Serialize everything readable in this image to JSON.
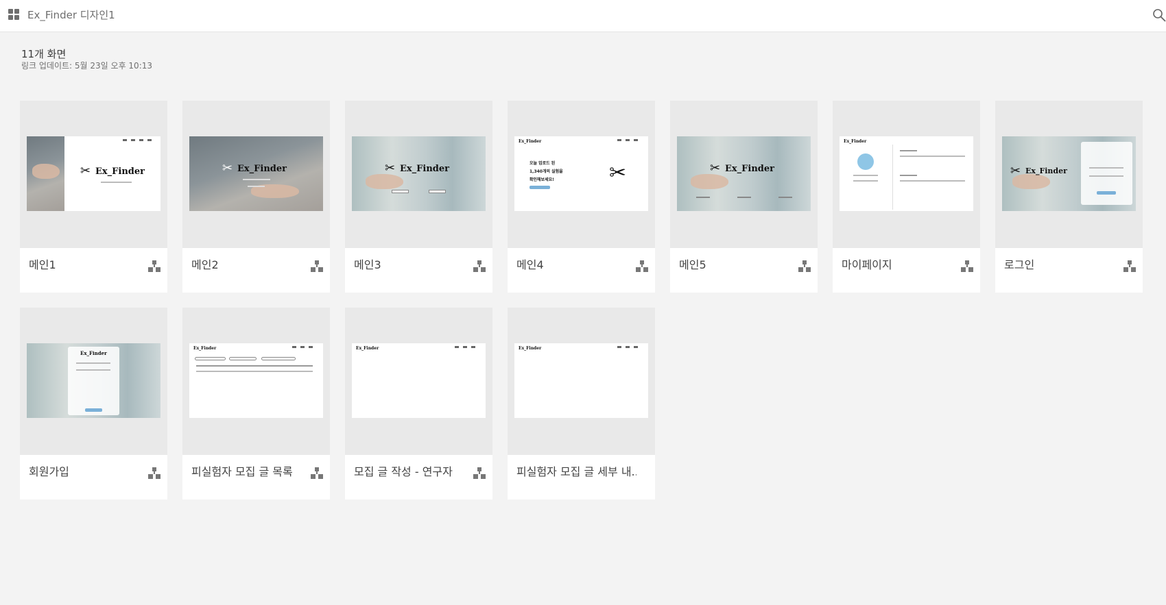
{
  "header": {
    "title": "Ex_Finder 디자인1",
    "menu_icon": "grid-icon",
    "search_icon": "search-icon"
  },
  "summary": {
    "screen_count": "11개 화면",
    "link_update": "링크 업데이트: 5월 23일 오후 10:13"
  },
  "screens": [
    {
      "label": "메인1"
    },
    {
      "label": "메인2"
    },
    {
      "label": "메인3"
    },
    {
      "label": "메인4"
    },
    {
      "label": "메인5"
    },
    {
      "label": "마이페이지"
    },
    {
      "label": "로그인"
    },
    {
      "label": "회원가입"
    },
    {
      "label": "피실험자 모집 글 목록"
    },
    {
      "label": "모집 글 작성 - 연구자"
    },
    {
      "label": "피실험자 모집 글 세부 내..."
    }
  ],
  "thumbnails": {
    "logo_text": "Ex_Finder",
    "main4_lines": [
      "오늘 업로드 된",
      "1,340개의 실험을",
      "확인해보세요!"
    ]
  },
  "colors": {
    "background": "#f3f3f3",
    "card": "#ffffff",
    "thumb_area": "#e9e9e9",
    "accent_blue": "#8fc6e6"
  }
}
